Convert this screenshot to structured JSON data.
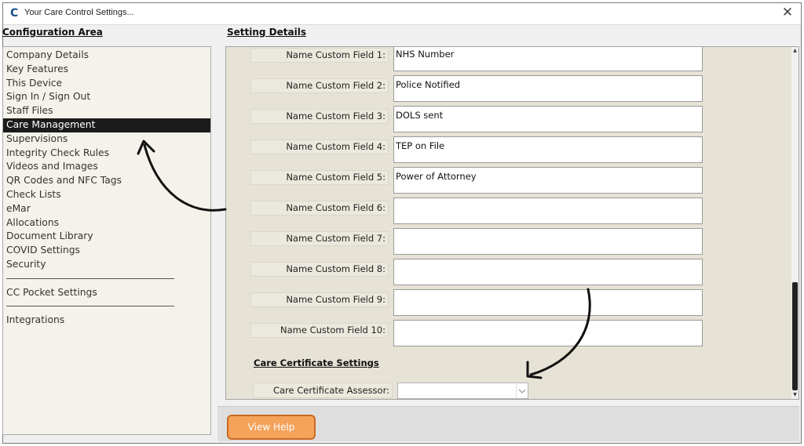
{
  "window": {
    "title": "Your Care Control Settings...",
    "app_icon_glyph": "C",
    "close_glyph": "✕"
  },
  "left_panel": {
    "heading": "Configuration Area",
    "items": [
      {
        "label": "Company Details"
      },
      {
        "label": "Key Features"
      },
      {
        "label": "This Device"
      },
      {
        "label": "Sign In / Sign Out"
      },
      {
        "label": "Staff Files"
      },
      {
        "label": "Care Management",
        "selected": true
      },
      {
        "label": "Supervisions"
      },
      {
        "label": "Integrity Check Rules"
      },
      {
        "label": "Videos and Images"
      },
      {
        "label": "QR Codes and NFC Tags"
      },
      {
        "label": "Check Lists"
      },
      {
        "label": "eMar"
      },
      {
        "label": "Allocations"
      },
      {
        "label": "Document Library"
      },
      {
        "label": "COVID Settings"
      },
      {
        "label": "Security"
      }
    ],
    "extra_items": [
      {
        "label": "CC Pocket Settings"
      },
      {
        "label": "Integrations"
      }
    ]
  },
  "right_panel": {
    "heading": "Setting Details",
    "custom_fields": [
      {
        "label": "Name Custom Field 1:",
        "value": "NHS Number"
      },
      {
        "label": "Name Custom Field 2:",
        "value": "Police Notified"
      },
      {
        "label": "Name Custom Field 3:",
        "value": "DOLS sent"
      },
      {
        "label": "Name Custom Field 4:",
        "value": "TEP on File"
      },
      {
        "label": "Name Custom Field 5:",
        "value": "Power of Attorney"
      },
      {
        "label": "Name Custom Field 6:",
        "value": ""
      },
      {
        "label": "Name Custom Field 7:",
        "value": ""
      },
      {
        "label": "Name Custom Field 8:",
        "value": ""
      },
      {
        "label": "Name Custom Field 9:",
        "value": ""
      },
      {
        "label": "Name Custom Field 10:",
        "value": ""
      }
    ],
    "care_certificate": {
      "heading": "Care Certificate Settings",
      "assessor_label": "Care Certificate Assessor:",
      "assessor_value": ""
    }
  },
  "bottom_bar": {
    "help_button": "View Help"
  },
  "colors": {
    "selected_bg": "#1b1b1b",
    "help_button": "#f5a25a",
    "content_bg": "#e6e3d6"
  }
}
